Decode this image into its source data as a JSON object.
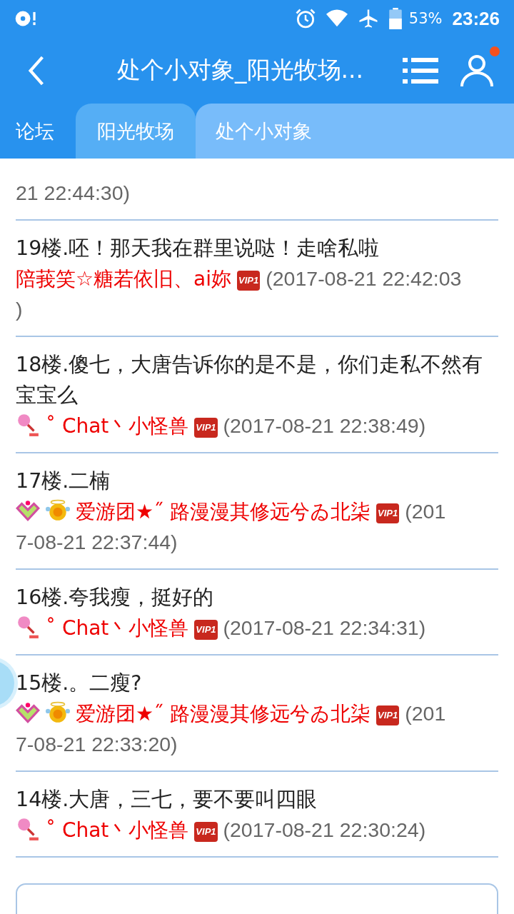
{
  "status_bar": {
    "battery": "53%",
    "time": "23:26"
  },
  "header": {
    "title": "处个小对象_阳光牧场...",
    "notification_dot": true
  },
  "tabs": [
    {
      "label": "论坛",
      "selected": false
    },
    {
      "label": "阳光牧场",
      "selected": false
    },
    {
      "label": "处个小对象",
      "selected": true
    }
  ],
  "posts": [
    {
      "time_lines": [
        "21 22:44:30)"
      ]
    },
    {
      "title": "19楼.呸！那天我在群里说哒！走啥私啦",
      "author": "陪莪笑☆糖若依旧、ai妳",
      "badge": "VIP1",
      "time_lines": [
        "(2017-08-21 22:42:03",
        ")"
      ]
    },
    {
      "title": "18楼.傻七，大唐告诉你的是不是，你们走私不然有宝宝么",
      "icons": [
        {
          "kind": "flower"
        }
      ],
      "author": "˚ Chat丶小怪兽",
      "badge": "VIP1",
      "time_lines": [
        "(2017-08-21 22:38:49)"
      ]
    },
    {
      "title": "17楼.二楠",
      "icons": [
        {
          "kind": "heart"
        },
        {
          "kind": "medal"
        }
      ],
      "author": "爱游团★˝ 路漫漫其修远兮ゐ北柒",
      "badge": "VIP1",
      "time_lines": [
        "(201",
        "7-08-21 22:37:44)"
      ]
    },
    {
      "title": "16楼.夸我瘦，挺好的",
      "icons": [
        {
          "kind": "flower"
        }
      ],
      "author": "˚ Chat丶小怪兽",
      "badge": "VIP1",
      "time_lines": [
        "(2017-08-21 22:34:31)"
      ]
    },
    {
      "title": "15楼.。二瘦?",
      "icons": [
        {
          "kind": "heart"
        },
        {
          "kind": "medal"
        }
      ],
      "author": "爱游团★˝ 路漫漫其修远兮ゐ北柒",
      "badge": "VIP1",
      "time_lines": [
        "(201",
        "7-08-21 22:33:20)"
      ]
    },
    {
      "title": "14楼.大唐，三七，要不要叫四眼",
      "icons": [
        {
          "kind": "flower"
        }
      ],
      "author": "˚ Chat丶小怪兽",
      "badge": "VIP1",
      "time_lines": [
        "(2017-08-21 22:30:24)"
      ]
    }
  ]
}
